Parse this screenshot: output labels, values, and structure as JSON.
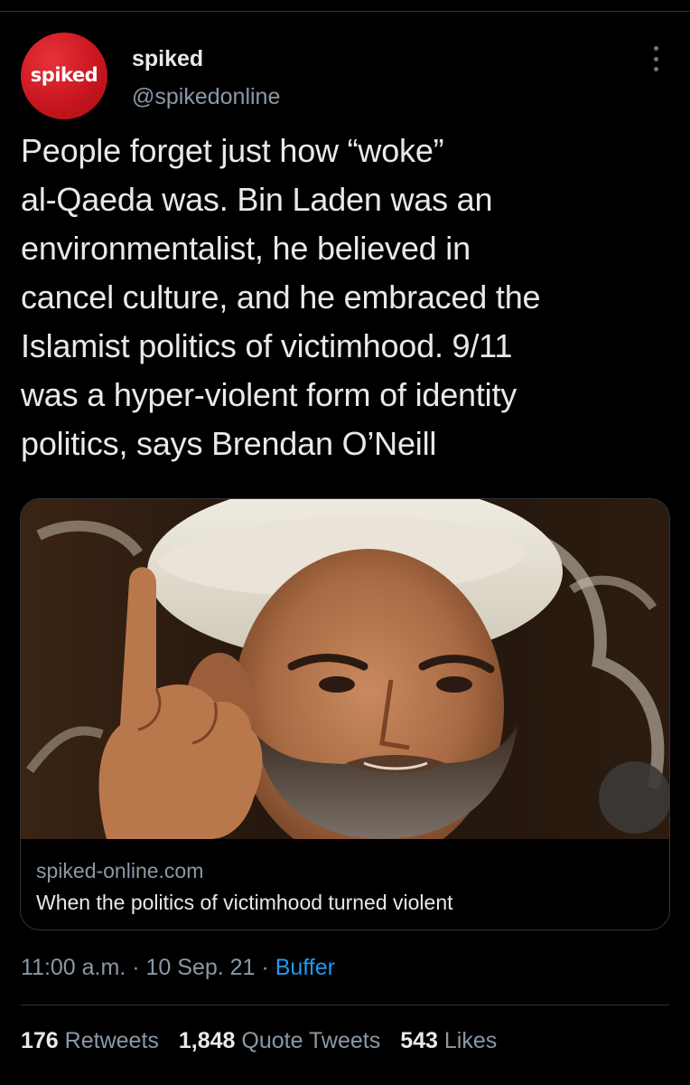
{
  "account": {
    "avatar_text": "spiked",
    "display_name": "spiked",
    "handle": "@spikedonline"
  },
  "tweet": {
    "text": "People forget just how “woke”\nal-Qaeda was. Bin Laden was an\nenvironmentalist, he believed in\ncancel culture, and he embraced the\nIslamist politics of victimhood. 9/11\nwas a hyper-violent form of identity\npolitics, says Brendan O’Neill"
  },
  "card": {
    "image_icon": "photo-of-man-in-white-turban-raising-finger",
    "domain": "spiked-online.com",
    "title": "When the politics of victimhood turned violent"
  },
  "meta": {
    "time": "11:00 a.m.",
    "separator": "·",
    "date": "10 Sep. 21",
    "source": "Buffer"
  },
  "stats": {
    "retweets_count": "176",
    "retweets_label": "Retweets",
    "quotes_count": "1,848",
    "quotes_label": "Quote Tweets",
    "likes_count": "543",
    "likes_label": "Likes"
  },
  "colors": {
    "background": "#000000",
    "text_primary": "#e7e9ea",
    "text_secondary": "#8b98a5",
    "link": "#1d9bf0",
    "avatar_red": "#c9161f",
    "border": "#2f3336"
  }
}
